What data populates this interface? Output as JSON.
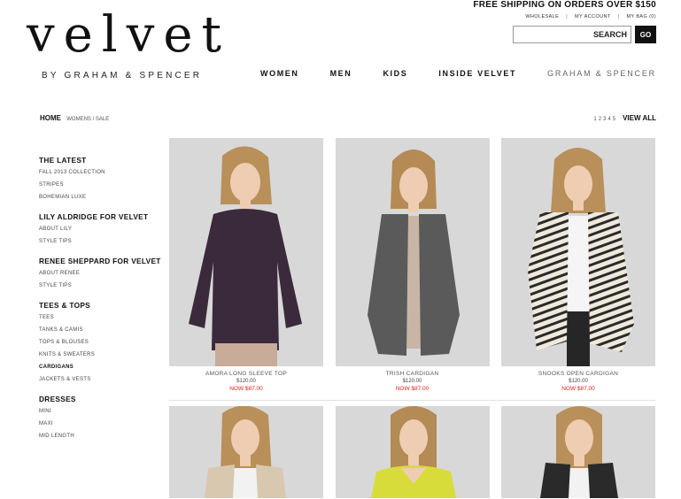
{
  "promo": "FREE SHIPPING ON ORDERS OVER $150",
  "util_links": [
    "WHOLESALE",
    "MY ACCOUNT",
    "MY BAG (0)"
  ],
  "search": {
    "placeholder": "SEARCH",
    "go_label": "GO"
  },
  "logo": {
    "main": "velvet",
    "sub": "BY GRAHAM & SPENCER"
  },
  "nav": [
    "WOMEN",
    "MEN",
    "KIDS",
    "INSIDE VELVET",
    "GRAHAM & SPENCER"
  ],
  "breadcrumb": {
    "home": "HOME",
    "trail": "WOMENS / SALE"
  },
  "pagination": {
    "pages": [
      "1",
      "2",
      "3",
      "4",
      "5"
    ],
    "view_all": "VIEW ALL"
  },
  "sidebar": [
    {
      "title": "THE LATEST",
      "items": [
        "FALL 2013 COLLECTION",
        "STRIPES",
        "BOHEMIAN LUXE"
      ]
    },
    {
      "title": "LILY ALDRIDGE FOR VELVET",
      "items": [
        "ABOUT LILY",
        "STYLE TIPS"
      ]
    },
    {
      "title": "RENEE SHEPPARD FOR VELVET",
      "items": [
        "ABOUT RENEE",
        "STYLE TIPS"
      ]
    },
    {
      "title": "TEES & TOPS",
      "items": [
        "TEES",
        "TANKS & CAMIS",
        "TOPS & BLOUSES",
        "KNITS & SWEATERS",
        "CARDIGANS",
        "JACKETS & VESTS"
      ],
      "active": "CARDIGANS"
    },
    {
      "title": "DRESSES",
      "items": [
        "MINI",
        "MAXI",
        "MID LENGTH"
      ]
    }
  ],
  "products": [
    {
      "name": "AMORA LONG SLEEVE TOP",
      "price": "$120.00",
      "sale": "NOW $87.00",
      "garment_color": "#3a2a3c"
    },
    {
      "name": "TRISH CARDIGAN",
      "price": "$120.00",
      "sale": "NOW $87.00",
      "garment_color": "#5a5a5a"
    },
    {
      "name": "SNOOKS OPEN CARDIGAN",
      "price": "$120.00",
      "sale": "NOW $87.00",
      "garment_color": "#efe9dc"
    }
  ],
  "products_row2": [
    {
      "garment_color": "#d9c8b0"
    },
    {
      "garment_color": "#d8dc3a"
    },
    {
      "garment_color": "#2a2a2a"
    }
  ],
  "colors": {
    "sale": "#d9241b",
    "photo_bg": "#dcdcdc"
  }
}
